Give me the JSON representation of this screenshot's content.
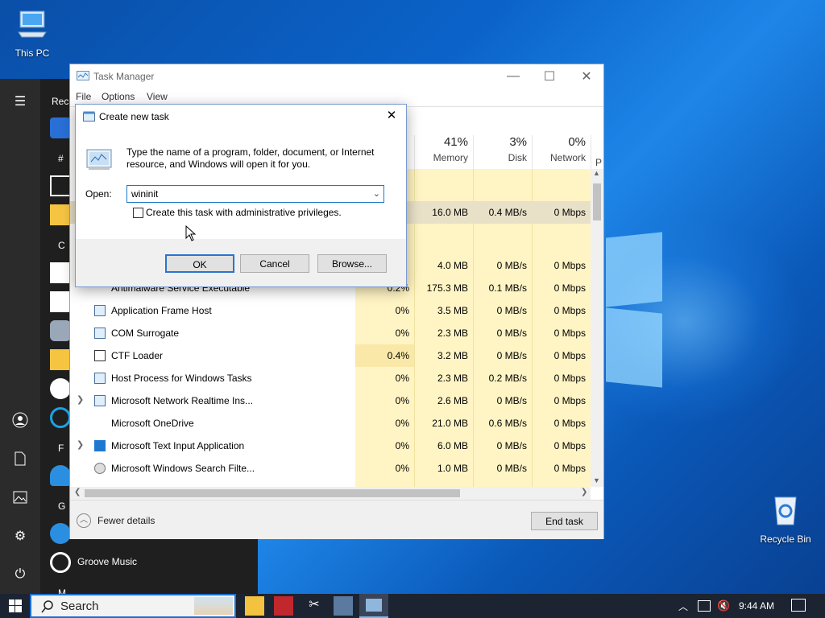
{
  "desktop": {
    "icons": [
      {
        "label": "This PC",
        "icon": "computer-icon"
      },
      {
        "label": "Recycle Bin",
        "icon": "recycle-bin-icon"
      }
    ]
  },
  "start_menu": {
    "header_partial": "Rece",
    "letters": [
      "#",
      "C",
      "F",
      "G",
      "M"
    ],
    "visible_app": "Groove Music"
  },
  "task_manager": {
    "title": "Task Manager",
    "menu": [
      "File",
      "Options",
      "View"
    ],
    "columns": [
      {
        "pct": "41%",
        "label": "Memory"
      },
      {
        "pct": "3%",
        "label": "Disk"
      },
      {
        "pct": "0%",
        "label": "Network"
      }
    ],
    "col_partial": "P",
    "rows": [
      {
        "name": "",
        "cpu": "",
        "mem": "16.0 MB",
        "disk": "0.4 MB/s",
        "net": "0 Mbps"
      },
      {
        "name": "",
        "cpu": "",
        "mem": "4.0 MB",
        "disk": "0 MB/s",
        "net": "0 Mbps"
      },
      {
        "name": "Antimalware Service Executable",
        "cpu": "0.2%",
        "mem": "175.3 MB",
        "disk": "0.1 MB/s",
        "net": "0 Mbps"
      },
      {
        "name": "Application Frame Host",
        "cpu": "0%",
        "mem": "3.5 MB",
        "disk": "0 MB/s",
        "net": "0 Mbps"
      },
      {
        "name": "COM Surrogate",
        "cpu": "0%",
        "mem": "2.3 MB",
        "disk": "0 MB/s",
        "net": "0 Mbps"
      },
      {
        "name": "CTF Loader",
        "cpu": "0.4%",
        "mem": "3.2 MB",
        "disk": "0 MB/s",
        "net": "0 Mbps"
      },
      {
        "name": "Host Process for Windows Tasks",
        "cpu": "0%",
        "mem": "2.3 MB",
        "disk": "0.2 MB/s",
        "net": "0 Mbps"
      },
      {
        "name": "Microsoft Network Realtime Ins...",
        "cpu": "0%",
        "mem": "2.6 MB",
        "disk": "0 MB/s",
        "net": "0 Mbps"
      },
      {
        "name": "Microsoft OneDrive",
        "cpu": "0%",
        "mem": "21.0 MB",
        "disk": "0.6 MB/s",
        "net": "0 Mbps"
      },
      {
        "name": "Microsoft Text Input Application",
        "cpu": "0%",
        "mem": "6.0 MB",
        "disk": "0 MB/s",
        "net": "0 Mbps"
      },
      {
        "name": "Microsoft Windows Search Filte...",
        "cpu": "0%",
        "mem": "1.0 MB",
        "disk": "0 MB/s",
        "net": "0 Mbps"
      }
    ],
    "fewer_details": "Fewer details",
    "end_task": "End task"
  },
  "dialog": {
    "title": "Create new task",
    "description": "Type the name of a program, folder, document, or Internet resource, and Windows will open it for you.",
    "open_label": "Open:",
    "open_value": "wininit",
    "admin_checkbox_label": "Create this task with administrative privileges.",
    "admin_checked": false,
    "ok": "OK",
    "cancel": "Cancel",
    "browse": "Browse..."
  },
  "taskbar": {
    "search_placeholder": "Search",
    "clock": "9:44 AM"
  }
}
